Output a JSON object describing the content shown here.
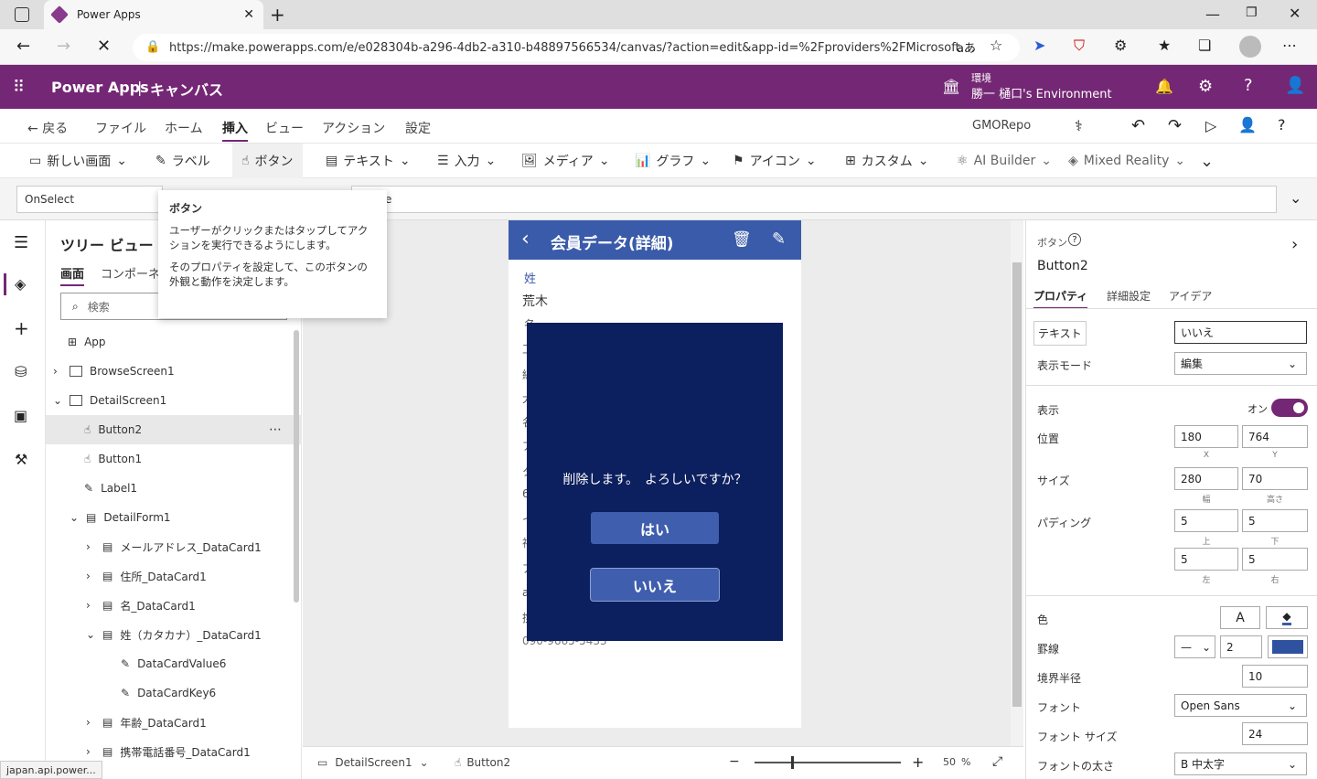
{
  "browser": {
    "tab_title": "Power Apps",
    "url": "https://make.powerapps.com/e/e028304b-a296-4db2-a310-b48897566534/canvas/?action=edit&app-id=%2Fproviders%2FMicrosoft....",
    "reading": "aあ"
  },
  "header": {
    "app": "Power Apps",
    "sep": "|",
    "mode": "キャンバス",
    "env_label": "環境",
    "env_name": "勝一 樋口's Environment"
  },
  "menu": {
    "back": "戻る",
    "items": [
      "ファイル",
      "ホーム",
      "挿入",
      "ビュー",
      "アクション",
      "設定"
    ],
    "repo": "GMORepo"
  },
  "ribbon": {
    "new_screen": "新しい画面",
    "label": "ラベル",
    "button": "ボタン",
    "text": "テキスト",
    "input": "入力",
    "media": "メディア",
    "chart": "グラフ",
    "icon": "アイコン",
    "custom": "カスタム",
    "ai": "AI Builder",
    "mr": "Mixed Reality"
  },
  "formula": {
    "property": "OnSelect",
    "value": "e"
  },
  "tooltip": {
    "title": "ボタン",
    "p1": "ユーザーがクリックまたはタップしてアクションを実行できるようにします。",
    "p2": "そのプロパティを設定して、このボタンの外観と動作を決定します。"
  },
  "tree": {
    "title": "ツリー ビュー",
    "tab1": "画面",
    "tab2": "コンポーネ",
    "search_placeholder": "検索",
    "nodes": [
      "App",
      "BrowseScreen1",
      "DetailScreen1",
      "Button2",
      "Button1",
      "Label1",
      "DetailForm1",
      "メールアドレス_DataCard1",
      "住所_DataCard1",
      "名_DataCard1",
      "姓（カタカナ）_DataCard1",
      "DataCardValue6",
      "DataCardKey6",
      "年齢_DataCard1",
      "携帯電話番号_DataCard1"
    ]
  },
  "screen": {
    "title": "会員データ(詳細)",
    "field1_label": "姓",
    "field1_value": "荒木",
    "partials": [
      "名",
      "工",
      "続",
      "大",
      "名",
      "ア",
      "タ",
      "6",
      "イ",
      "神",
      "ア",
      "a",
      "携"
    ],
    "phone": "090-9665-5433",
    "dialog": {
      "message": "削除します。　よろしいですか？",
      "yes": "はい",
      "no": "いいえ"
    }
  },
  "status": {
    "screen": "DetailScreen1",
    "control": "Button2",
    "zoom": "50",
    "zoom_unit": "%",
    "url_hint": "japan.api.power..."
  },
  "props": {
    "type": "ボタン",
    "name": "Button2",
    "tabs": [
      "プロパティ",
      "詳細設定",
      "アイデア"
    ],
    "text_label": "テキスト",
    "text_value": "いいえ",
    "display_mode_label": "表示モード",
    "display_mode": "編集",
    "visible_label": "表示",
    "visible_value": "オン",
    "position_label": "位置",
    "x": "180",
    "y": "764",
    "x_sub": "X",
    "y_sub": "Y",
    "size_label": "サイズ",
    "width": "280",
    "height": "70",
    "w_sub": "幅",
    "h_sub": "高さ",
    "padding_label": "パディング",
    "pad_top": "5",
    "pad_bottom": "5",
    "pad_left": "5",
    "pad_right": "5",
    "top_sub": "上",
    "bottom_sub": "下",
    "left_sub": "左",
    "right_sub": "右",
    "color_label": "色",
    "color_a": "A",
    "border_label": "罫線",
    "border_width": "2",
    "radius_label": "境界半径",
    "radius": "10",
    "font_label": "フォント",
    "font": "Open Sans",
    "font_size_label": "フォント サイズ",
    "font_size": "24",
    "font_weight_label": "フォントの太さ",
    "font_weight": "B 中太字"
  },
  "colors": {
    "brand": "#742774",
    "dialog_bg": "#0c1f5e",
    "screen_header": "#3a5ba9",
    "button": "#3f5fae"
  }
}
